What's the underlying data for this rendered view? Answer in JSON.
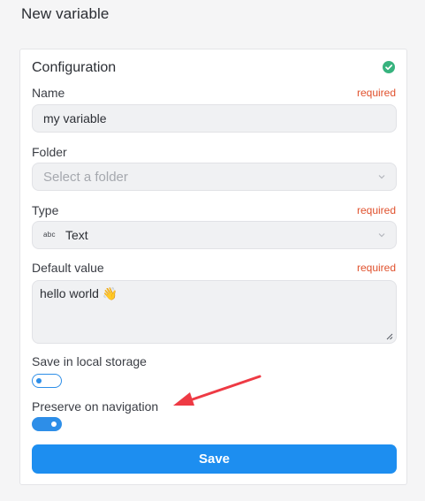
{
  "page": {
    "title": "New variable"
  },
  "config": {
    "title": "Configuration",
    "status_icon": "check-circle-icon",
    "status_color": "#37b37e"
  },
  "fields": {
    "name": {
      "label": "Name",
      "required": "required",
      "value": "my variable"
    },
    "folder": {
      "label": "Folder",
      "placeholder": "Select a folder"
    },
    "type": {
      "label": "Type",
      "required": "required",
      "icon_text": "abc",
      "value": "Text"
    },
    "default_value": {
      "label": "Default value",
      "required": "required",
      "value": "hello world 👋"
    },
    "local_storage": {
      "label": "Save in local storage",
      "enabled": false
    },
    "preserve": {
      "label": "Preserve on navigation",
      "enabled": true
    }
  },
  "actions": {
    "save_label": "Save"
  },
  "colors": {
    "accent": "#1d8ef0",
    "required": "#e0512d",
    "annotation_arrow": "#ee3a44"
  }
}
